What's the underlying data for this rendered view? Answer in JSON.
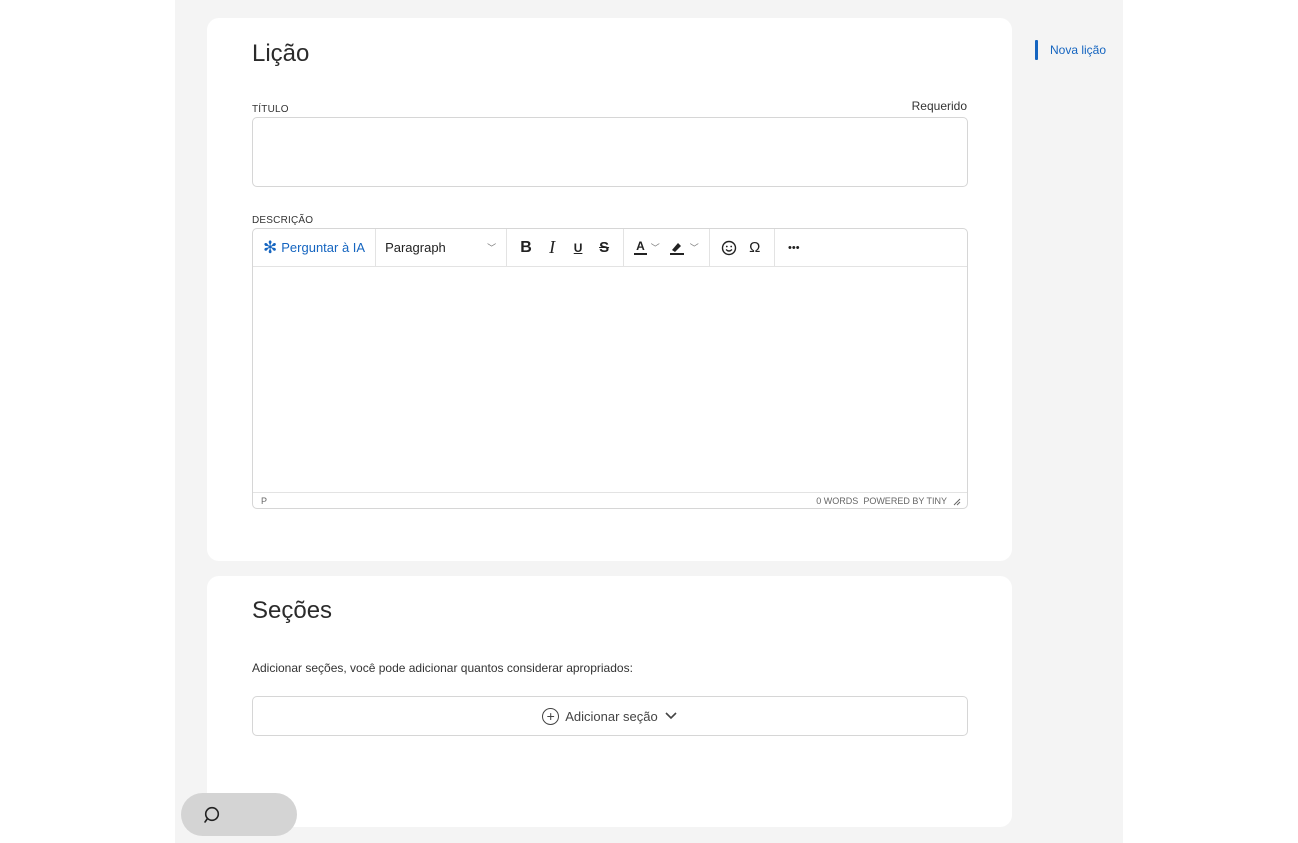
{
  "lesson": {
    "heading": "Lição",
    "title_label": "TÍTULO",
    "required_label": "Requerido",
    "title_value": "",
    "description_label": "DESCRIÇÃO"
  },
  "editor": {
    "ai_button": "Perguntar à IA",
    "block_format": "Paragraph",
    "bold": "B",
    "italic": "I",
    "underline": "U",
    "strike": "S",
    "text_color": "A",
    "special_char": "Ω",
    "more": "•••",
    "status_path": "P",
    "word_count": "0 WORDS",
    "powered_by": "POWERED BY TINY"
  },
  "sections": {
    "heading": "Seções",
    "hint": "Adicionar seções, você pode adicionar quantos considerar apropriados:",
    "add_button": "Adicionar seção"
  },
  "side_nav": {
    "item": "Nova lição"
  },
  "colors": {
    "accent": "#1565c0",
    "page_bg": "#f4f4f4",
    "card_bg": "#ffffff",
    "border": "#d6d6d6"
  }
}
